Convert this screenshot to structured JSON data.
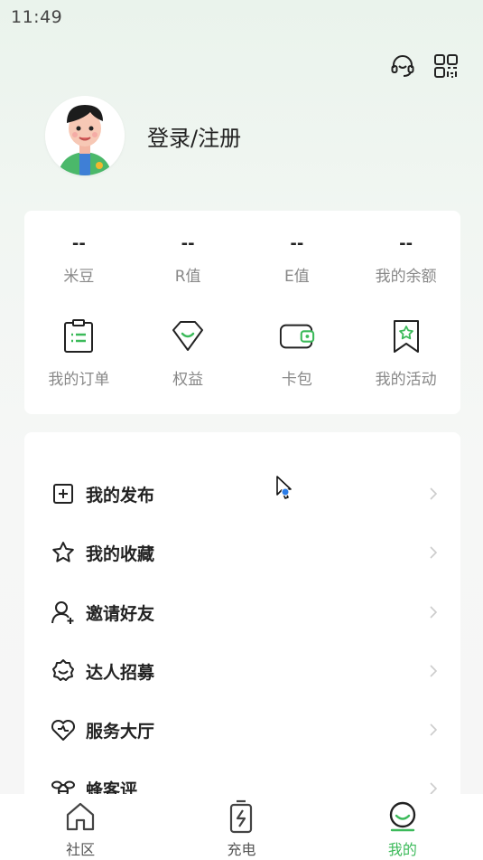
{
  "status_bar": {
    "time": "11:49"
  },
  "header": {
    "support_icon": "headset-icon",
    "scan_icon": "qr-code-icon"
  },
  "profile": {
    "login_text": "登录/注册"
  },
  "stats": [
    {
      "value": "--",
      "label": "米豆"
    },
    {
      "value": "--",
      "label": "R值"
    },
    {
      "value": "--",
      "label": "E值"
    },
    {
      "value": "--",
      "label": "我的余额"
    }
  ],
  "actions": [
    {
      "label": "我的订单",
      "icon": "order-clipboard-icon"
    },
    {
      "label": "权益",
      "icon": "benefits-badge-icon"
    },
    {
      "label": "卡包",
      "icon": "card-wallet-icon"
    },
    {
      "label": "我的活动",
      "icon": "activity-bookmark-icon"
    }
  ],
  "menu": [
    {
      "label": "我的发布",
      "icon": "publish-plus-icon"
    },
    {
      "label": "我的收藏",
      "icon": "star-icon"
    },
    {
      "label": "邀请好友",
      "icon": "invite-user-icon"
    },
    {
      "label": "达人招募",
      "icon": "recruit-badge-icon"
    },
    {
      "label": "服务大厅",
      "icon": "service-heart-icon"
    },
    {
      "label": "蜂客评",
      "icon": "bee-icon"
    }
  ],
  "tabbar": {
    "items": [
      {
        "label": "社区",
        "icon": "community-house-icon",
        "active": false
      },
      {
        "label": "充电",
        "icon": "charging-icon",
        "active": false
      },
      {
        "label": "我的",
        "icon": "profile-face-icon",
        "active": true
      }
    ]
  },
  "colors": {
    "accent": "#3cba5a",
    "text": "#222222",
    "muted": "#888888"
  }
}
